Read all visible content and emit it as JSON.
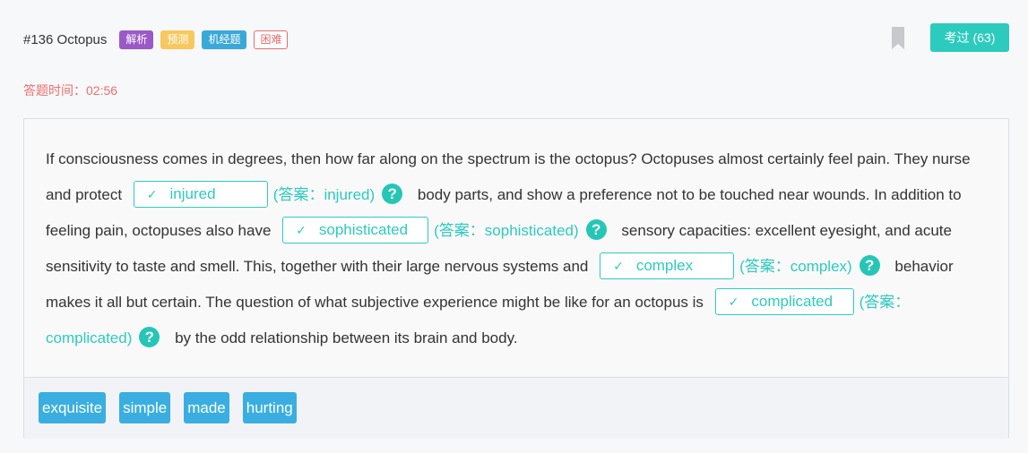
{
  "header": {
    "title": "#136 Octopus",
    "tags": [
      "解析",
      "预测",
      "机经题",
      "困难"
    ],
    "exam_button": "考过 (63)"
  },
  "timer": "答题时间：02:56",
  "passage": {
    "segments": [
      {
        "type": "text",
        "value": "If consciousness comes in degrees, then how far along on the spectrum is the octopus? Octopuses almost certainly feel pain. They nurse and protect "
      },
      {
        "type": "blank",
        "value": "injured",
        "answer": "(答案：injured)"
      },
      {
        "type": "text",
        "value": " body parts, and show a preference not to be touched near wounds. In addition to feeling pain, octopuses also have "
      },
      {
        "type": "blank",
        "value": "sophisticated",
        "answer": "(答案：sophisticated)"
      },
      {
        "type": "text",
        "value": " sensory capacities: excellent eyesight, and acute sensitivity to taste and smell. This, together with their large nervous systems and "
      },
      {
        "type": "blank",
        "value": "complex",
        "answer": "(答案：complex)"
      },
      {
        "type": "text",
        "value": " behavior makes it all but certain. The question of what subjective experience might be like for an octopus is "
      },
      {
        "type": "blank",
        "value": "complicated",
        "answer": "(答案：complicated)"
      },
      {
        "type": "text",
        "value": " by the odd relationship between its brain and body."
      }
    ]
  },
  "options": [
    "exquisite",
    "simple",
    "made",
    "hurting"
  ],
  "icons": {
    "check": "check-icon",
    "help": "help-icon",
    "bookmark": "bookmark-icon"
  },
  "colors": {
    "accent": "#2dcbbd",
    "timer": "#ec6f6f",
    "option": "#3aaee0"
  }
}
